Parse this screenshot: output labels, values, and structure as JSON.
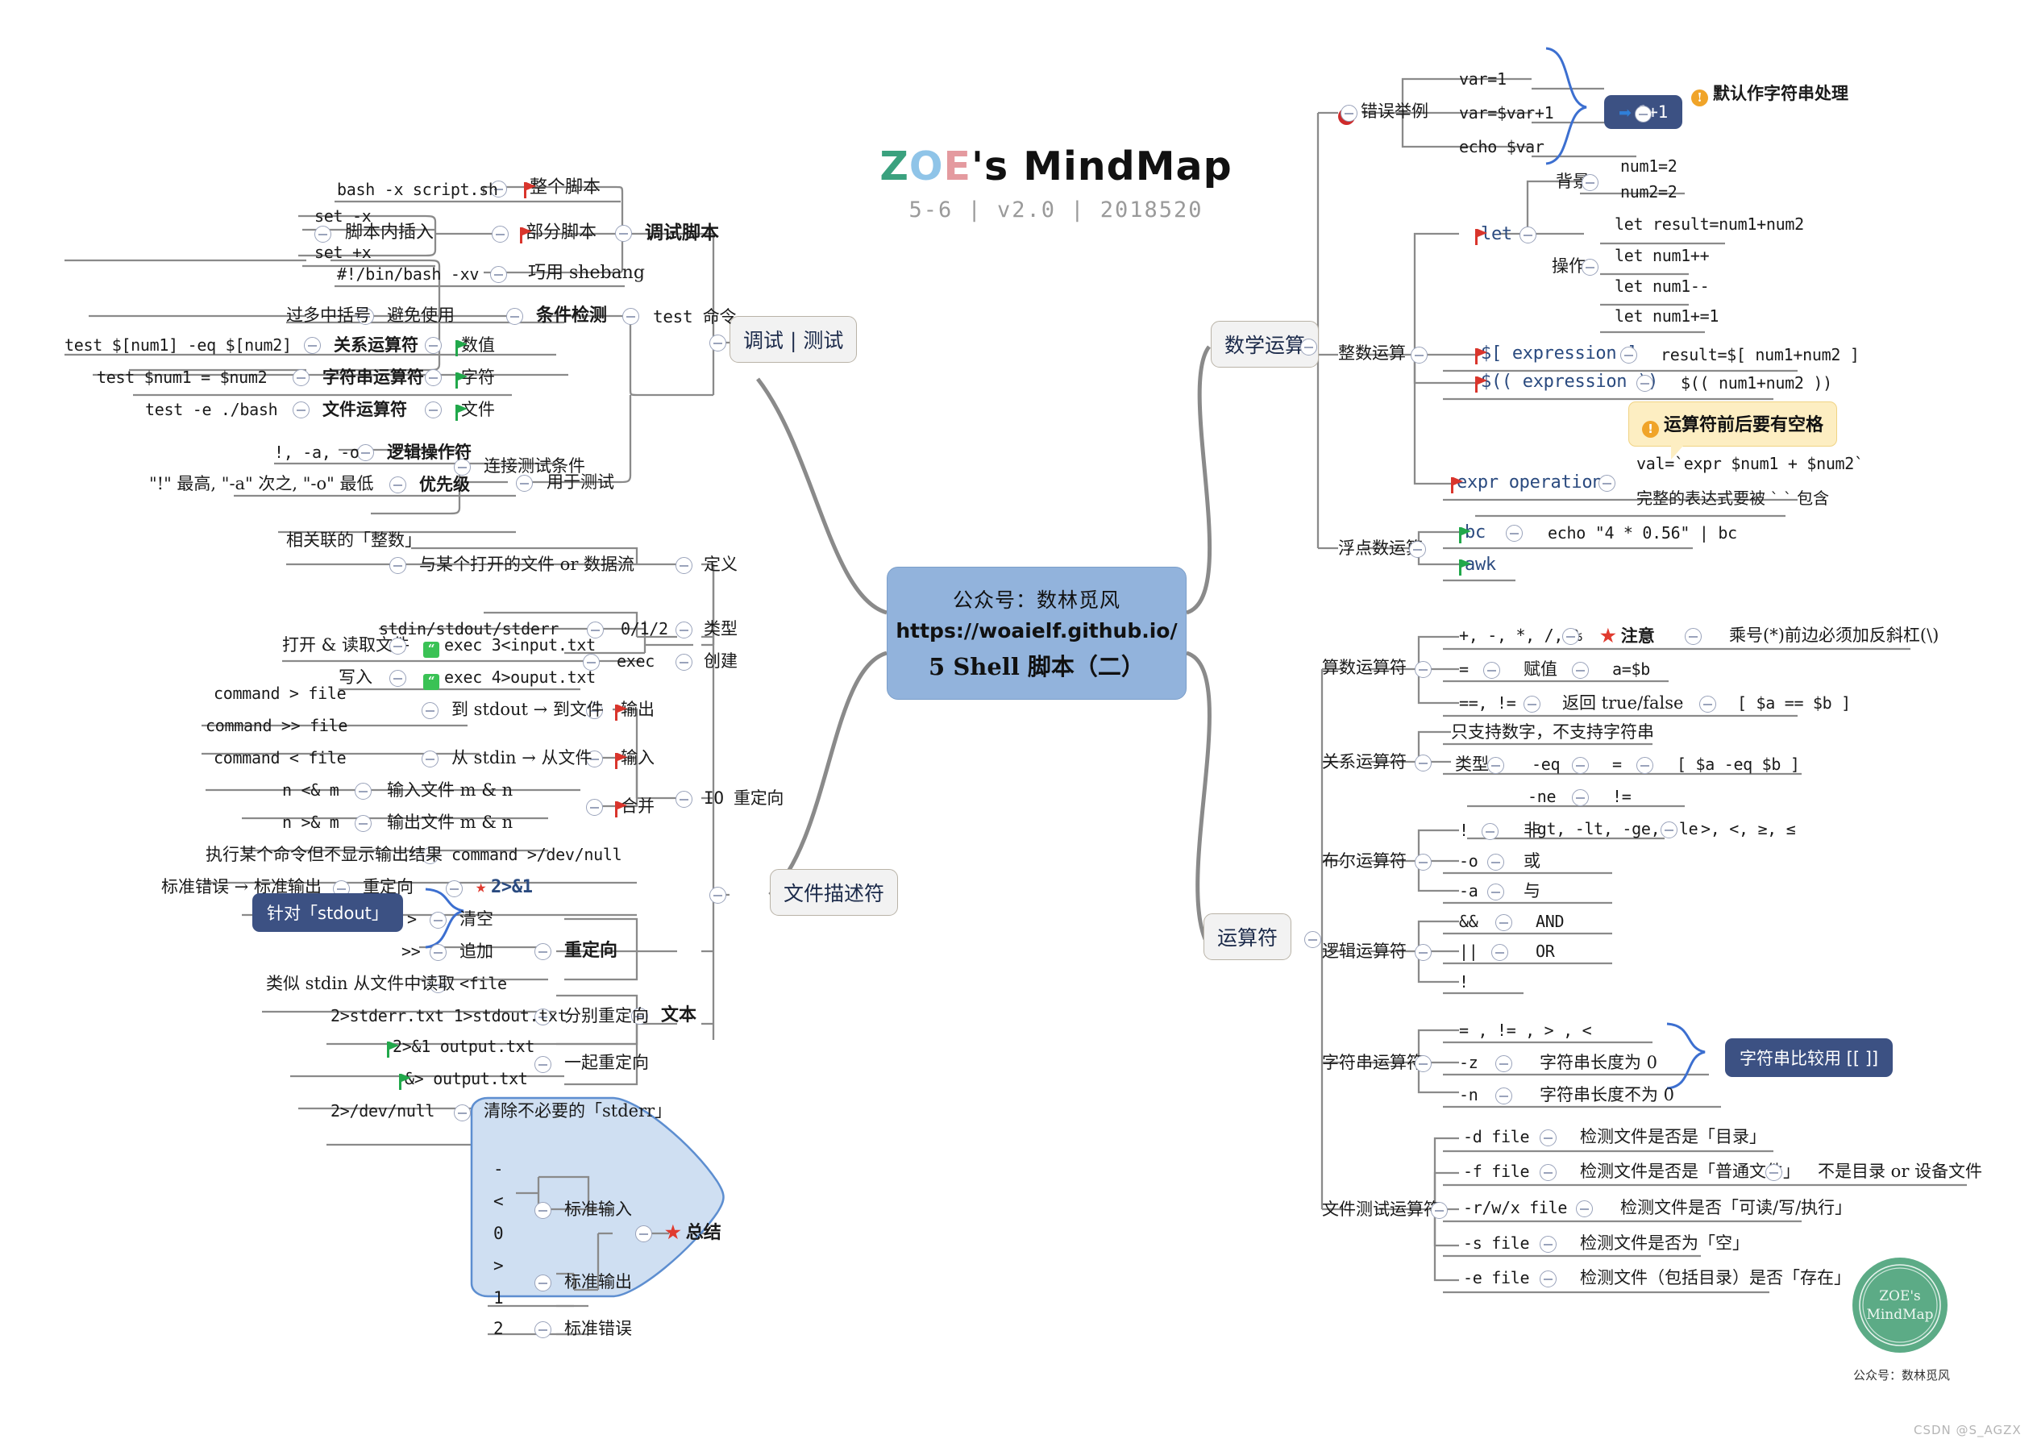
{
  "title": {
    "z": "Z",
    "o": "O",
    "e": "E",
    "rest": "'s MindMap",
    "subtitle": "5-6 | v2.0 | 2018520"
  },
  "central": {
    "line1": "公众号：数林觅风",
    "line2": "https://woaielf.github.io/",
    "line3": "5 Shell 脚本（二）"
  },
  "branches": {
    "debug": "调试 | 测试",
    "math": "数学运算",
    "fd": "文件描述符",
    "operators": "运算符"
  },
  "debug_branch": {
    "debug_script": "调试脚本",
    "whole_script": "整个脚本",
    "whole_script_cmd": "bash -x script.sh",
    "insert_in_script": "脚本内插入",
    "partial_script": "部分脚本",
    "set_x": "set -x",
    "set_plus_x": "set +x",
    "shebang_trick": "巧用 shebang",
    "shebang_cmd": "#!/bin/bash -xv",
    "test_cmd": "test 命令",
    "cond_check": "条件检测",
    "avoid_use": "避免使用",
    "too_many_brackets": "过多中括号",
    "for_test": "用于测试",
    "numeric": "数值",
    "relational_op": "关系运算符",
    "relational_ex": "test $[num1] -eq $[num2]",
    "string": "字符",
    "string_op": "字符串运算符",
    "string_ex": "test $num1 = $num2",
    "file": "文件",
    "file_op": "文件运算符",
    "file_ex": "test -e ./bash",
    "connect_cond": "连接测试条件",
    "logic_op": "逻辑操作符",
    "logic_ops_list": "!, -a, -o",
    "priority": "优先级",
    "priority_desc": "\"!\" 最高, \"-a\" 次之, \"-o\" 最低"
  },
  "math_branch": {
    "error_example": "错误举例",
    "err1": "var=1",
    "err2": "var=$var+1",
    "err3": "echo $var",
    "result_1plus1": "1+1",
    "default_string": "默认作字符串处理",
    "int_math": "整数运算",
    "let": "let",
    "background": "背景",
    "bg1": "num1=2",
    "bg2": "num2=2",
    "operation": "操作",
    "op1": "let result=num1+num2",
    "op2": "let num1++",
    "op3": "let num1--",
    "op4": "let num1+=1",
    "dollar_bracket": "$[ expression ]",
    "dollar_bracket_ex": "result=$[ num1+num2 ]",
    "dollar_paren": "$(( expression ))",
    "dollar_paren_ex": "$(( num1+num2 ))",
    "space_warning": "运算符前后要有空格",
    "expr_operation": "expr operation",
    "expr_ex": "val=`expr $num1 + $num2`",
    "expr_note": "完整的表达式要被 ` ` 包含",
    "float_math": "浮点数运算",
    "bc": "bc",
    "bc_ex": "echo \"4 * 0.56\" | bc",
    "awk": "awk"
  },
  "fd_branch": {
    "definition": "定义",
    "def_desc": "与某个打开的文件 or 数据流",
    "def_detail": "相关联的「整数」",
    "type": "类型",
    "type_code": "0/1/2",
    "type_names": "stdin/stdout/stderr",
    "create": "创建",
    "exec": "exec",
    "open_read": "打开 & 读取文件",
    "exec_in": "exec 3<input.txt",
    "write": "写入",
    "exec_out": "exec 4>ouput.txt",
    "io_redirect": "IO 重定向",
    "output": "输出",
    "output_desc": "到 stdout → 到文件",
    "out1": "command > file",
    "out2": "command >> file",
    "input": "输入",
    "input_desc": "从 stdin → 从文件",
    "in1": "command < file",
    "merge": "合并",
    "merge1_desc": "输入文件 m & n",
    "merge1": "n <& m",
    "merge2_desc": "输出文件 m & n",
    "merge2": "n >& m",
    "devnull_desc": "执行某个命令但不显示输出结果",
    "devnull": "command >/dev/null",
    "stderr_to_stdout_desc": "标准错误 → 标准输出",
    "redirect_label": "重定向",
    "stderr_to_stdout": "2>&1",
    "redirect": "重定向",
    "for_stdout": "针对「stdout」",
    "clear": "清空",
    "clear_op": ">",
    "append": "追加",
    "append_op": ">>",
    "read_like_stdin": "类似 stdin 从文件中读取",
    "read_op": "<file",
    "text": "文本",
    "separate_redirect": "分别重定向",
    "separate_ex": "2>stderr.txt 1>stdout.txt",
    "together_redirect": "一起重定向",
    "together1": "2>&1 output.txt",
    "together2": "&> output.txt",
    "clear_stderr": "清除不必要的「stderr」",
    "clear_stderr_op": "2>/dev/null",
    "summary": "总结",
    "stdin_label": "标准输入",
    "stdin_1": "-",
    "stdin_2": "<",
    "stdin_3": "0",
    "stdout_label": "标准输出",
    "stdout_1": ">",
    "stdout_2": "1",
    "stderr_label": "标准错误",
    "stderr_1": "2"
  },
  "operators_branch": {
    "arith": "算数运算符",
    "arith_ops": "+, -, *, /, %",
    "note": "注意",
    "note_desc": "乘号(*)前边必须加反斜杠(\\)",
    "assign_op": "=",
    "assign_label": "赋值",
    "assign_ex": "a=$b",
    "eq_ops": "==, !=",
    "eq_label": "返回 true/false",
    "eq_ex": "[ $a == $b ]",
    "relational": "关系运算符",
    "rel_note": "只支持数字，不支持字符串",
    "rel_type": "类型",
    "eq": "-eq",
    "eq_sym": "=",
    "eq_example": "[ $a -eq $b ]",
    "ne": "-ne",
    "ne_sym": "!=",
    "cmp_ops": "-gt, -lt, -ge, -le",
    "cmp_syms": ">, <, ≥, ≤",
    "bool": "布尔运算符",
    "not_op": "!",
    "not_label": "非",
    "or_op": "-o",
    "or_label": "或",
    "and_op": "-a",
    "and_label": "与",
    "logic": "逻辑运算符",
    "and2": "&&",
    "and2_label": "AND",
    "or2": "||",
    "or2_label": "OR",
    "not2": "!",
    "string": "字符串运算符",
    "str_ops": "= , != , > , <",
    "z_op": "-z",
    "z_label": "字符串长度为 0",
    "n_op": "-n",
    "n_label": "字符串长度不为 0",
    "str_compare_note": "字符串比较用 [[ ]]",
    "file_test": "文件测试运算符",
    "d_file": "-d file",
    "d_desc": "检测文件是否是「目录」",
    "f_file": "-f file",
    "f_desc": "检测文件是否是「普通文件」",
    "f_desc2": "不是目录 or 设备文件",
    "rwx_file": "-r/w/x file",
    "rwx_desc": "检测文件是否「可读/写/执行」",
    "s_file": "-s file",
    "s_desc": "检测文件是否为「空」",
    "e_file": "-e file",
    "e_desc": "检测文件（包括目录）是否「存在」"
  },
  "footer": {
    "seal_line1": "ZOE's",
    "seal_line2": "MindMap",
    "seal_caption": "公众号：数林觅风",
    "watermark": "CSDN @S_AGZX"
  },
  "colors": {
    "central_fill": "#92b3dc",
    "branch_fill": "#f2f2f2",
    "dark_box": "#3c5183",
    "yellow_box": "#fdeec2",
    "flag_red": "#d9352c",
    "flag_green": "#21a84b",
    "seal_green": "#5cab86"
  }
}
